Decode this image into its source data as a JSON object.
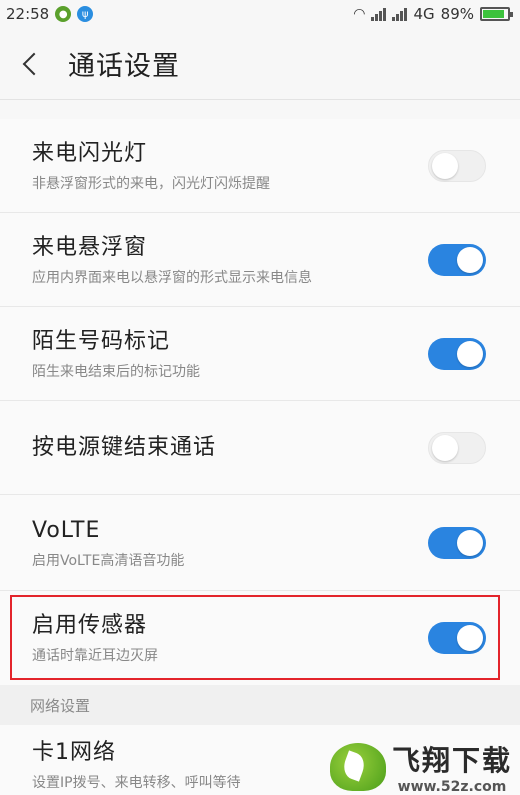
{
  "status_bar": {
    "time": "22:58",
    "network": "4G",
    "battery": "89%",
    "battery_level": 0.89
  },
  "header": {
    "title": "通话设置"
  },
  "items": [
    {
      "title": "来电闪光灯",
      "subtitle": "非悬浮窗形式的来电，闪光灯闪烁提醒",
      "enabled": false
    },
    {
      "title": "来电悬浮窗",
      "subtitle": "应用内界面来电以悬浮窗的形式显示来电信息",
      "enabled": true
    },
    {
      "title": "陌生号码标记",
      "subtitle": "陌生来电结束后的标记功能",
      "enabled": true
    },
    {
      "title": "按电源键结束通话",
      "subtitle": "",
      "enabled": false
    },
    {
      "title": "VoLTE",
      "subtitle": "启用VoLTE高清语音功能",
      "enabled": true
    },
    {
      "title": "启用传感器",
      "subtitle": "通话时靠近耳边灭屏",
      "enabled": true
    }
  ],
  "section": {
    "label": "网络设置"
  },
  "network_item": {
    "title": "卡1网络",
    "subtitle": "设置IP拨号、来电转移、呼叫等待"
  },
  "watermark": {
    "brand": "飞翔下载",
    "url": "www.52z.com"
  },
  "colors": {
    "accent": "#2a84e0",
    "highlight": "#e3242b"
  }
}
